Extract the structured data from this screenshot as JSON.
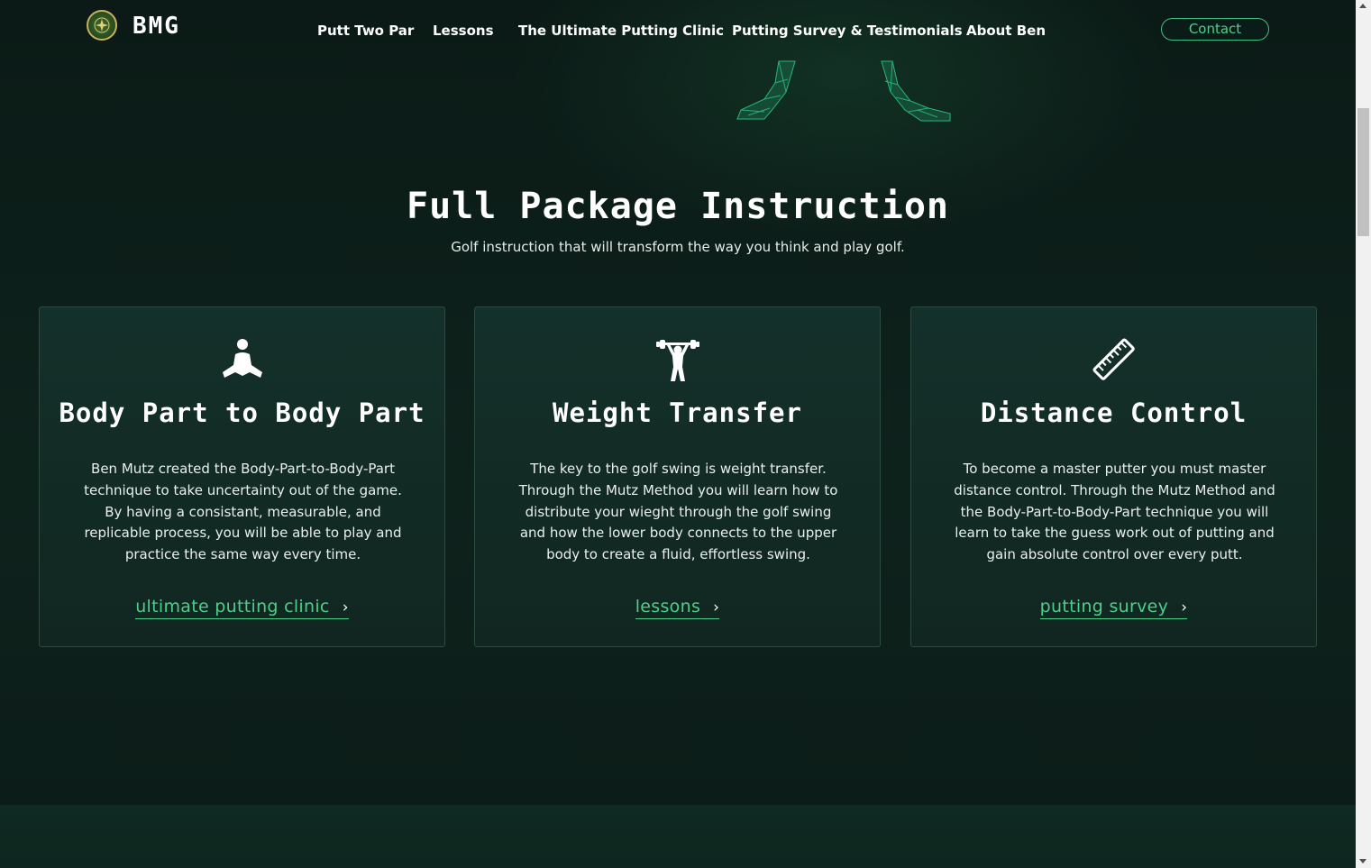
{
  "brand": {
    "name": "BMG",
    "logo_icon": "crest-logo-icon"
  },
  "nav": {
    "links": [
      "Putt Two Par",
      "Lessons",
      "The Ultimate Putting Clinic",
      "Putting Survey & Testimonials",
      "About Ben"
    ],
    "contact_label": "Contact"
  },
  "section": {
    "title": "Full Package Instruction",
    "subtitle": "Golf instruction that will transform the way you think and play golf."
  },
  "cards": [
    {
      "icon": "person-sitting-icon",
      "title": "Body Part to Body Part",
      "body": "Ben Mutz created the Body-Part-to-Body-Part technique to take uncertainty out of the game. By having a consistant, measurable, and replicable process, you will be able to play and practice the same way every time.",
      "link": "ultimate putting clinic"
    },
    {
      "icon": "weightlifter-icon",
      "title": "Weight Transfer",
      "body": "The key to the golf swing is weight transfer. Through the Mutz Method you will learn how to distribute your wieght through the golf swing and how the lower body connects to the upper body to create a fluid, effortless swing.",
      "link": "lessons"
    },
    {
      "icon": "ruler-icon",
      "title": "Distance Control",
      "body": "To become a master putter you must master distance control. Through the Mutz Method and the Body-Part-to-Body-Part technique you will learn to take the guess work out of putting and gain absolute control over every putt.",
      "link": "putting survey"
    }
  ],
  "colors": {
    "accent": "#4dcf8a",
    "background": "#0c1d18",
    "card": "#132c26"
  }
}
